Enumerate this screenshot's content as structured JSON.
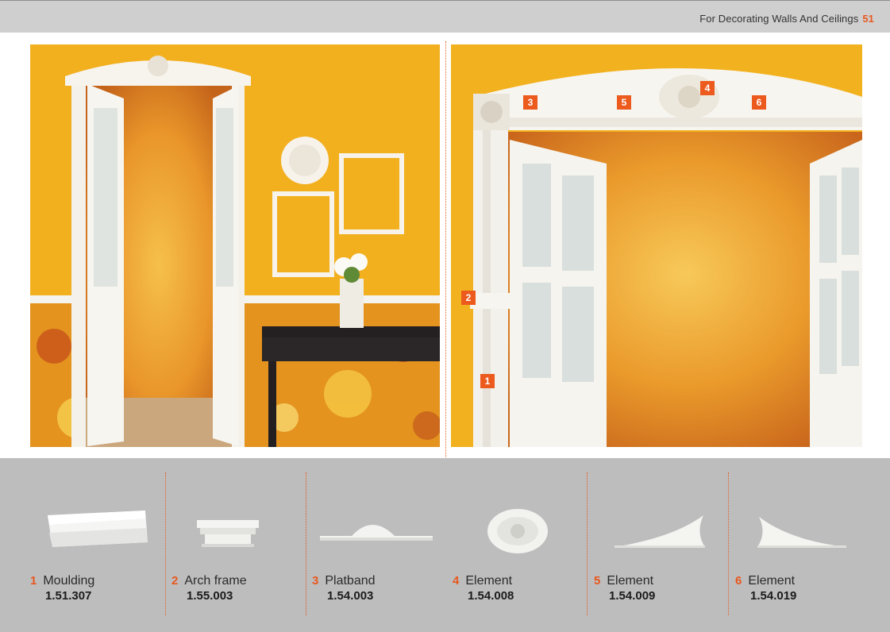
{
  "header": {
    "title": "For Decorating Walls And Ceilings",
    "page_number": "51"
  },
  "colors": {
    "accent": "#ec5a1e",
    "wall": "#f3b41e",
    "strip": "#bdbdbe",
    "header": "#cfcfcf"
  },
  "photos": {
    "left": {
      "alt": "hallway-with-double-doors"
    },
    "right": {
      "alt": "door-frame-closeup"
    }
  },
  "markers": [
    {
      "number": "1"
    },
    {
      "number": "2"
    },
    {
      "number": "3"
    },
    {
      "number": "4"
    },
    {
      "number": "5"
    },
    {
      "number": "6"
    }
  ],
  "products": [
    {
      "number": "1",
      "name": "Moulding",
      "code": "1.51.307"
    },
    {
      "number": "2",
      "name": "Arch frame",
      "code": "1.55.003"
    },
    {
      "number": "3",
      "name": "Platband",
      "code": "1.54.003"
    },
    {
      "number": "4",
      "name": "Element",
      "code": "1.54.008"
    },
    {
      "number": "5",
      "name": "Element",
      "code": "1.54.009"
    },
    {
      "number": "6",
      "name": "Element",
      "code": "1.54.019"
    }
  ]
}
